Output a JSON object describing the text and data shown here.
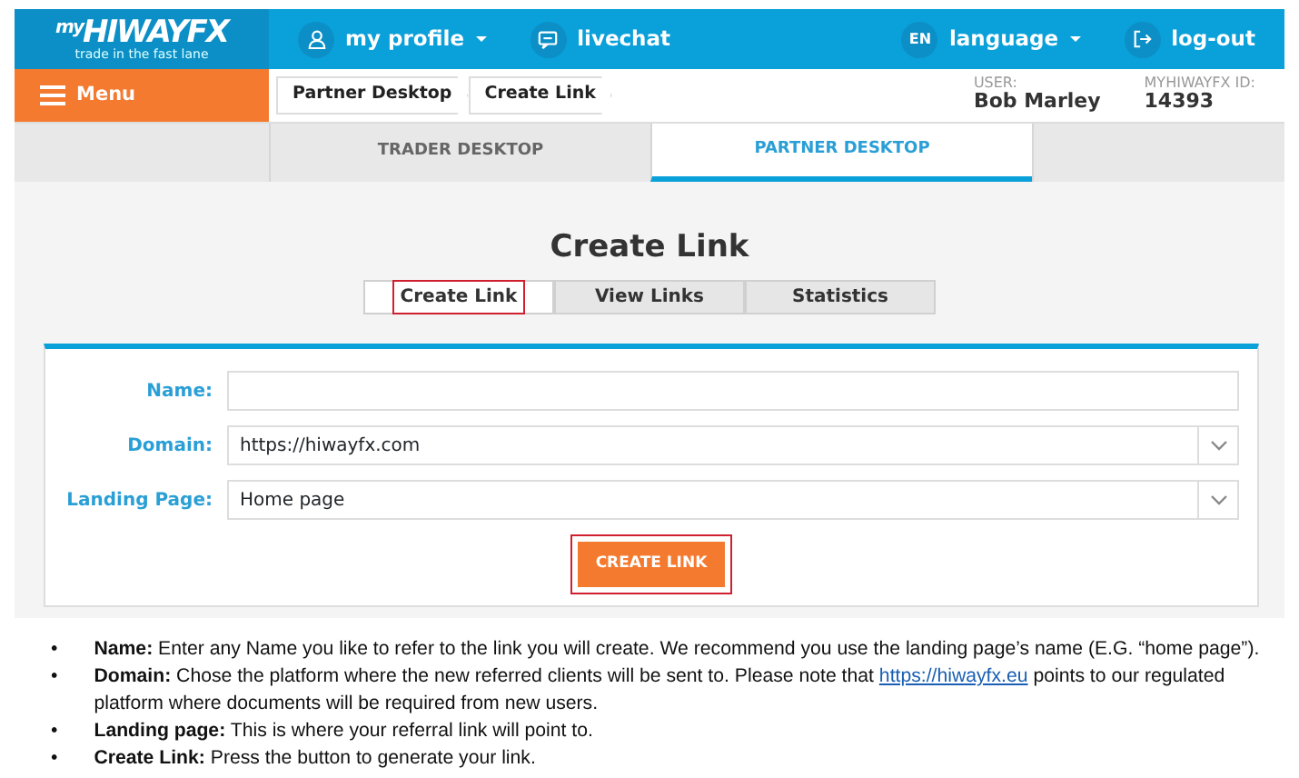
{
  "header": {
    "logo": {
      "prefix": "my",
      "name": "HIWAYFX",
      "tagline": "trade in the fast lane"
    },
    "nav": [
      {
        "kind": "profile",
        "label": "my profile",
        "dropdown": true
      },
      {
        "kind": "chat",
        "label": "livechat",
        "dropdown": false
      }
    ],
    "language": {
      "code": "EN",
      "label": "language",
      "dropdown": true
    },
    "logout": {
      "label": "log-out"
    }
  },
  "menu_button": {
    "label": "Menu"
  },
  "breadcrumb": [
    "Partner Desktop",
    "Create Link"
  ],
  "user": {
    "user_label": "USER:",
    "user_name": "Bob Marley",
    "id_label": "MYHIWAYFX ID:",
    "id_value": "14393"
  },
  "desk_tabs": [
    {
      "label": "TRADER DESKTOP",
      "selected": false
    },
    {
      "label": "PARTNER DESKTOP",
      "selected": true
    }
  ],
  "page_title": "Create Link",
  "sub_tabs": [
    {
      "label": "Create Link",
      "selected": true,
      "highlighted": true
    },
    {
      "label": "View Links",
      "selected": false,
      "highlighted": false
    },
    {
      "label": "Statistics",
      "selected": false,
      "highlighted": false
    }
  ],
  "form": {
    "fields": [
      {
        "kind": "text",
        "label": "Name:"
      },
      {
        "kind": "select",
        "label": "Domain:",
        "value": "https://hiwayfx.com"
      },
      {
        "kind": "select",
        "label": "Landing Page:",
        "value": "Home page"
      }
    ],
    "submit": {
      "label": "CREATE LINK",
      "highlighted": true
    }
  },
  "notes": [
    {
      "marker": "•",
      "label": "Name:",
      "text": " Enter any Name you like to refer to the link you will create. We recommend you use the landing page’s name (E.G. “home page”)."
    },
    {
      "marker": "•",
      "label": "Domain:",
      "text": " Chose the platform where the new referred clients will be sent to. Please note that ",
      "link": "https://hiwayfx.eu",
      "text_after": " points to our regulated platform where documents will be required from new users."
    },
    {
      "marker": "•",
      "label": "Landing page:",
      "text": " This is where your referral link will point to."
    },
    {
      "marker": "•",
      "label": "Create Link:",
      "text": " Press the button to generate your link."
    }
  ]
}
